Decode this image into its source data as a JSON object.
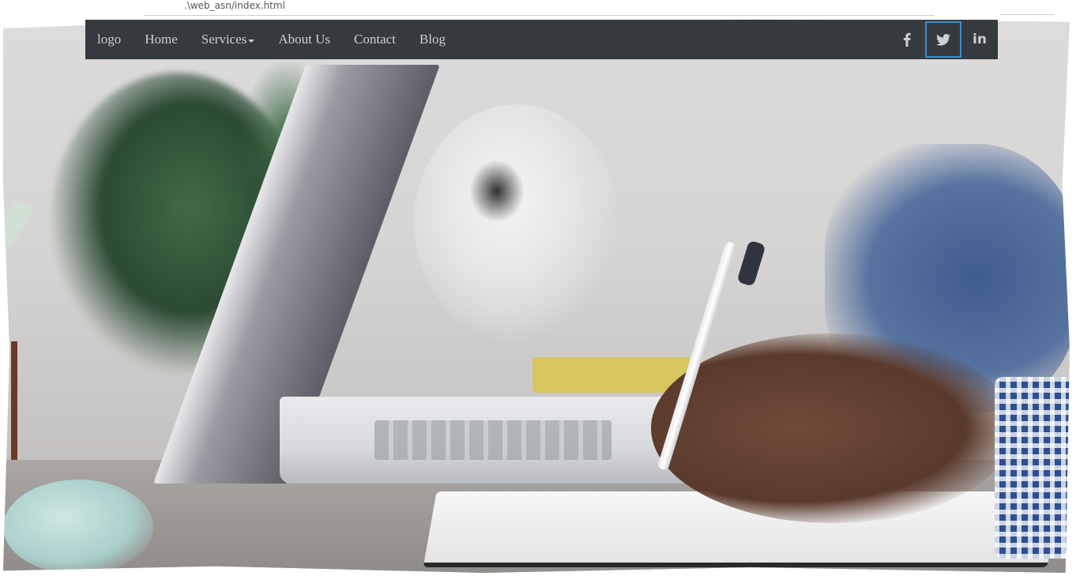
{
  "browser": {
    "url_fragment": ".\\web_asn/index.html"
  },
  "navbar": {
    "logo": "logo",
    "links": [
      {
        "label": "Home"
      },
      {
        "label": "Services",
        "dropdown": true
      },
      {
        "label": "About Us"
      },
      {
        "label": "Contact"
      },
      {
        "label": "Blog"
      }
    ],
    "social": [
      {
        "icon": "facebook-icon",
        "glyph": "f"
      },
      {
        "icon": "twitter-icon",
        "glyph": "twitter",
        "focused": true
      },
      {
        "icon": "linkedin-icon",
        "glyph": "in"
      }
    ]
  },
  "colors": {
    "navbar_bg": "#343a3d",
    "nav_text": "#cfcfcf",
    "focus_ring": "#3a8dd6"
  }
}
